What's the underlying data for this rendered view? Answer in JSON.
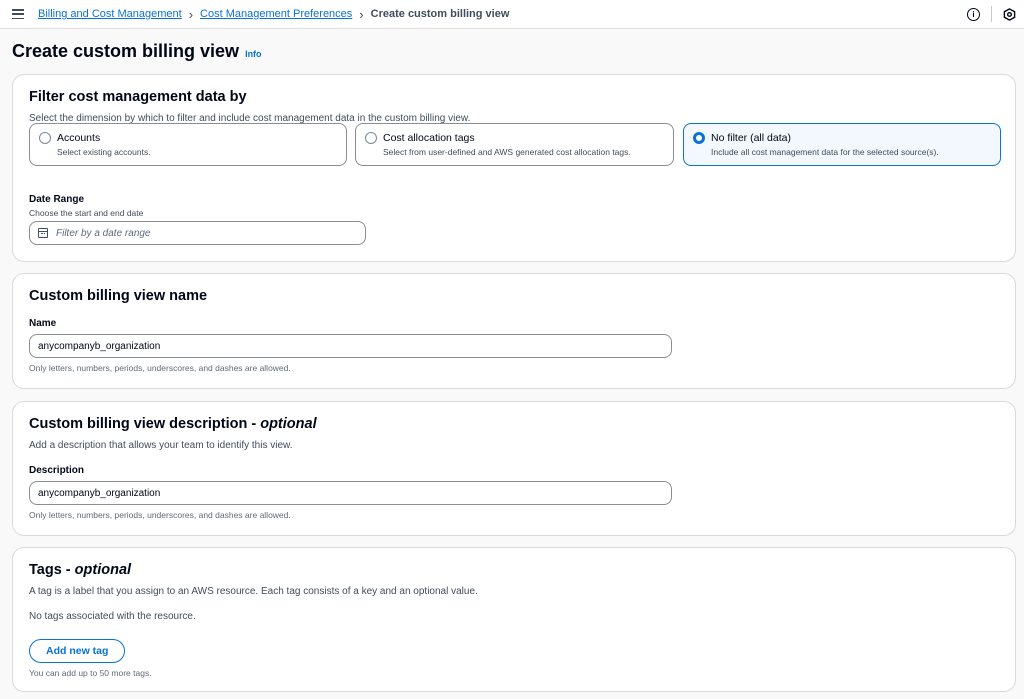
{
  "breadcrumbs": {
    "item1": "Billing and Cost Management",
    "item2": "Cost Management Preferences",
    "current": "Create custom billing view"
  },
  "header": {
    "title": "Create custom billing view",
    "info": "Info"
  },
  "filter": {
    "title": "Filter cost management data by",
    "description": "Select the dimension by which to filter and include cost management data in the custom billing view.",
    "options": [
      {
        "label": "Accounts",
        "desc": "Select existing accounts.",
        "selected": false
      },
      {
        "label": "Cost allocation tags",
        "desc": "Select from user-defined and AWS generated cost allocation tags.",
        "selected": false
      },
      {
        "label": "No filter (all data)",
        "desc": "Include all cost management data for the selected source(s).",
        "selected": true
      }
    ],
    "date_label": "Date Range",
    "date_sub": "Choose the start and end date",
    "date_placeholder": "Filter by a date range"
  },
  "name_section": {
    "title": "Custom billing view name",
    "label": "Name",
    "value": "anycompanyb_organization",
    "hint": "Only letters, numbers, periods, underscores, and dashes are allowed."
  },
  "desc_section": {
    "title": "Custom billing view description - ",
    "optional": "optional",
    "description": "Add a description that allows your team to identify this view.",
    "label": "Description",
    "value": "anycompanyb_organization",
    "hint": "Only letters, numbers, periods, underscores, and dashes are allowed."
  },
  "tags_section": {
    "title": "Tags - ",
    "optional": "optional",
    "description": "A tag is a label that you assign to an AWS resource. Each tag consists of a key and an optional value.",
    "empty": "No tags associated with the resource.",
    "button": "Add new tag",
    "hint": "You can add up to 50 more tags."
  },
  "colors": {
    "accent": "#0972d3",
    "text": "#000716",
    "muted": "#414d5c"
  }
}
